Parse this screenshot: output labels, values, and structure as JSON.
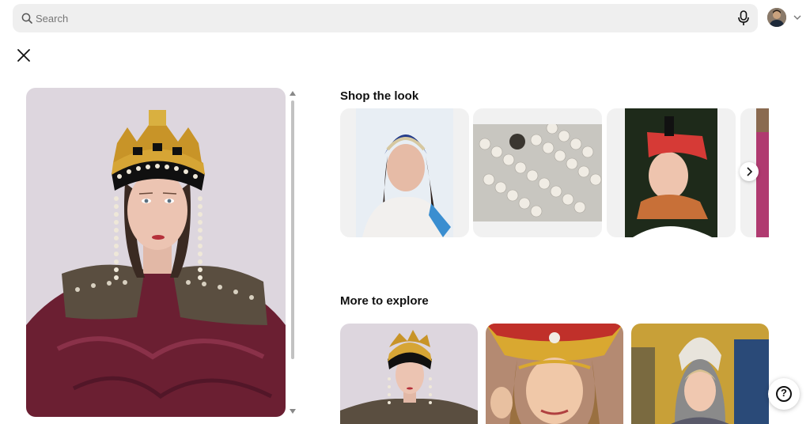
{
  "search": {
    "placeholder": "Search",
    "value": ""
  },
  "icons": {
    "search": "search-icon",
    "mic": "microphone-icon",
    "close": "close-icon",
    "chevron_down": "chevron-down-icon",
    "chevron_right": "chevron-right-icon",
    "help": "help-icon"
  },
  "sections": {
    "shop_title": "Shop the look",
    "explore_title": "More to explore"
  },
  "help": {
    "label": "?"
  }
}
